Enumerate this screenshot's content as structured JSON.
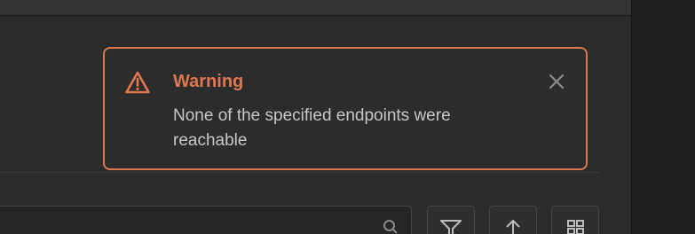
{
  "toast": {
    "type": "warning",
    "title": "Warning",
    "message": "None of the specified endpoints were reachable",
    "accent_color": "#e0784f",
    "icon": "warning-triangle-icon",
    "close_icon": "close-icon"
  },
  "toolbar": {
    "search_icon": "search-icon",
    "buttons": [
      {
        "icon": "filter-icon"
      },
      {
        "icon": "sort-icon"
      },
      {
        "icon": "grid-view-icon"
      }
    ]
  }
}
